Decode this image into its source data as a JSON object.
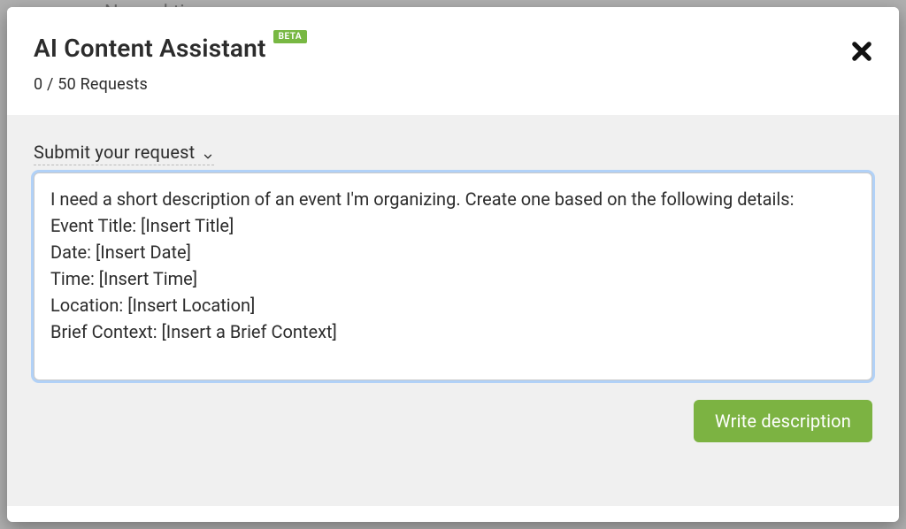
{
  "backdrop": {
    "partial_text": "No and time"
  },
  "modal": {
    "title": "AI Content Assistant",
    "badge": "BETA",
    "requests_label": "0 / 50 Requests",
    "section_label": "Submit your request",
    "textarea_value": "I need a short description of an event I'm organizing. Create one based on the following details:\nEvent Title: [Insert Title]\nDate: [Insert Date]\nTime: [Insert Time]\nLocation: [Insert Location]\nBrief Context: [Insert a Brief Context]",
    "write_button": "Write description"
  }
}
